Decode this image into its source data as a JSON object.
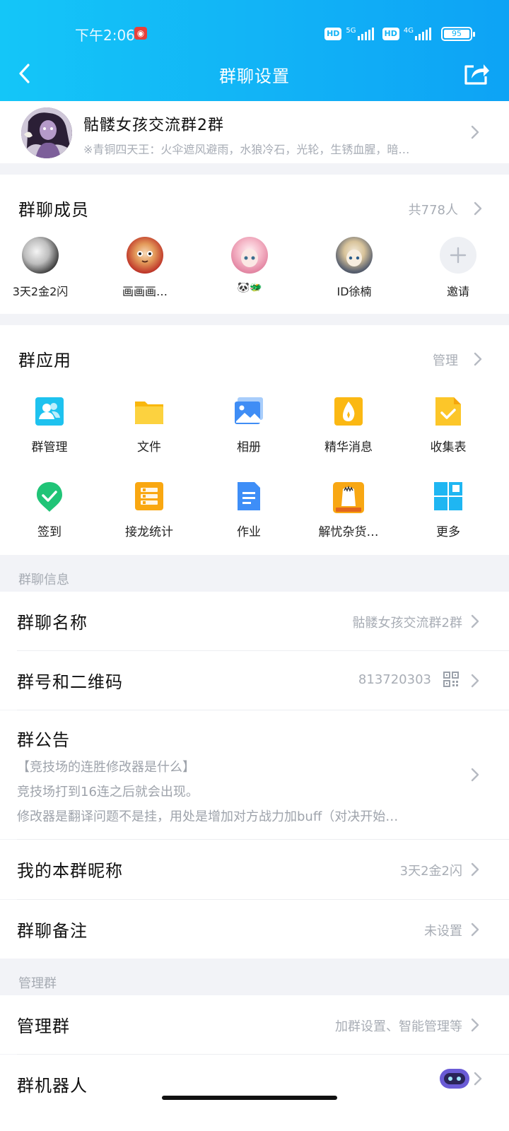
{
  "status_bar": {
    "time": "下午2:06",
    "hd": "HD",
    "net1": "5G",
    "net2": "4G",
    "battery": "95"
  },
  "header": {
    "title": "群聊设置",
    "back_icon": "chevron-left-icon",
    "share_icon": "share-icon"
  },
  "group": {
    "name": "骷髅女孩交流群2群",
    "description": "※青铜四天王：火伞遮风避雨，水狼冷石，光轮，生锈血腥，暗…"
  },
  "members": {
    "title": "群聊成员",
    "count": "共778人",
    "list": [
      {
        "name": "3天2金2闪"
      },
      {
        "name": "画画画…"
      },
      {
        "name": "🐼🐲"
      },
      {
        "name": "ID徐楠"
      }
    ],
    "invite_label": "邀请"
  },
  "apps": {
    "title": "群应用",
    "manage": "管理",
    "items": [
      {
        "label": "群管理",
        "icon": "group-manage-icon"
      },
      {
        "label": "文件",
        "icon": "folder-icon"
      },
      {
        "label": "相册",
        "icon": "album-icon"
      },
      {
        "label": "精华消息",
        "icon": "essence-icon"
      },
      {
        "label": "收集表",
        "icon": "form-icon"
      },
      {
        "label": "签到",
        "icon": "checkin-icon"
      },
      {
        "label": "接龙统计",
        "icon": "relay-icon"
      },
      {
        "label": "作业",
        "icon": "homework-icon"
      },
      {
        "label": "解忧杂货…",
        "icon": "store-icon"
      },
      {
        "label": "更多",
        "icon": "more-grid-icon"
      }
    ]
  },
  "info": {
    "section": "群聊信息",
    "name_label": "群聊名称",
    "name_value": "骷髅女孩交流群2群",
    "number_label": "群号和二维码",
    "number_value": "813720303",
    "notice_label": "群公告",
    "notice_lines": [
      "【竞技场的连胜修改器是什么】",
      "竞技场打到16连之后就会出现。",
      "修改器是翻译问题不是挂，用处是增加对方战力加buff（对决开始…"
    ],
    "nickname_label": "我的本群昵称",
    "nickname_value": "3天2金2闪",
    "remark_label": "群聊备注",
    "remark_value": "未设置"
  },
  "manage": {
    "section": "管理群",
    "label": "管理群",
    "value": "加群设置、智能管理等",
    "robot_label": "群机器人"
  },
  "colors": {
    "header_start": "#14c6f8",
    "header_end": "#0da3f5",
    "bg": "#f2f3f7"
  }
}
